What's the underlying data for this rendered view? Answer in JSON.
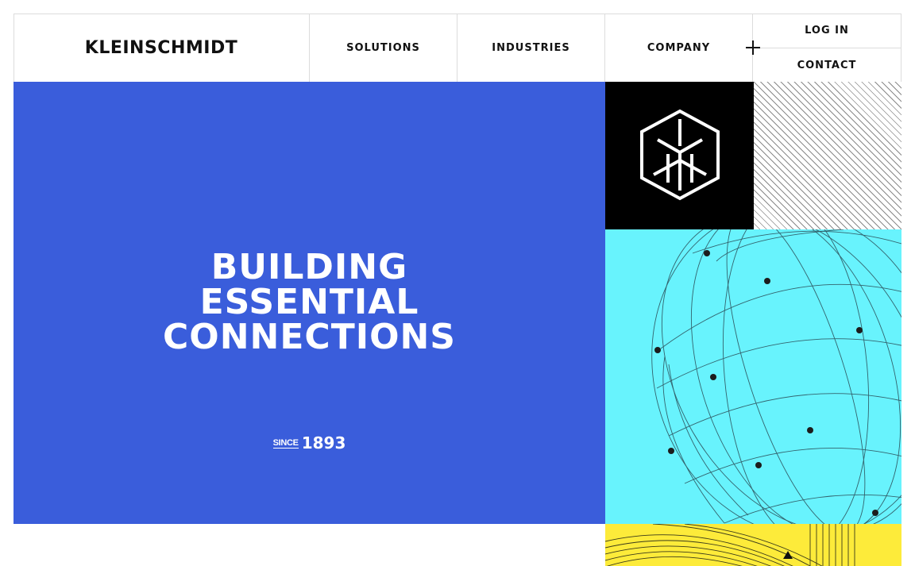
{
  "brand": {
    "name": "KLEINSCHMIDT"
  },
  "nav": {
    "items": [
      {
        "label": "SOLUTIONS"
      },
      {
        "label": "INDUSTRIES"
      },
      {
        "label": "COMPANY"
      }
    ],
    "expand_icon": "plus-icon"
  },
  "auth": {
    "login_label": "LOG IN",
    "contact_label": "CONTACT"
  },
  "hero": {
    "title_lines": [
      "BUILDING",
      "ESSENTIAL",
      "CONNECTIONS"
    ],
    "since_label": "SINCE",
    "since_year": "1893",
    "background_color": "#3a5ddb"
  },
  "tiles": {
    "logo_icon": "kleinschmidt-cube-logo-icon",
    "globe_icon": "wireframe-globe-icon",
    "colors": {
      "black": "#000000",
      "cyan": "#68f3fd",
      "yellow": "#fdeb3a"
    }
  }
}
